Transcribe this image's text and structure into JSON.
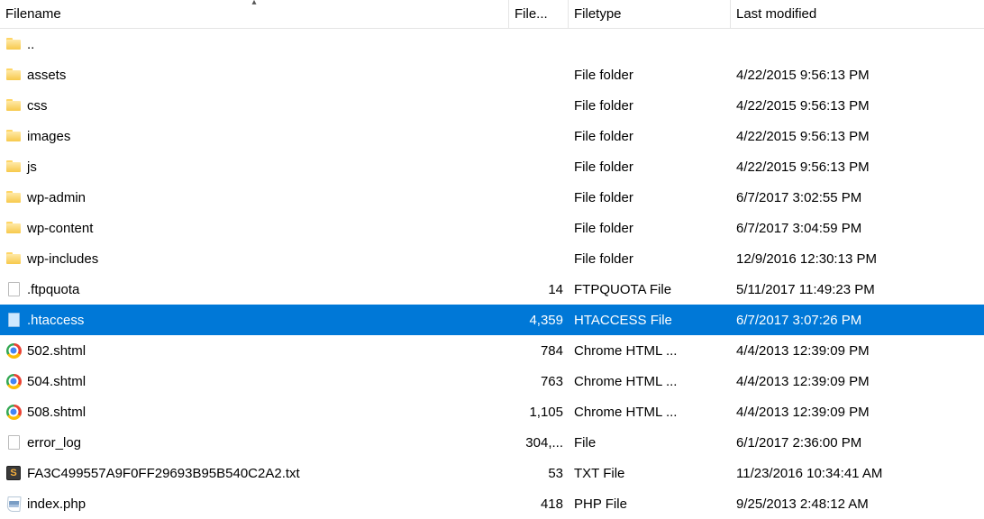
{
  "columns": {
    "filename": "Filename",
    "filesize": "File...",
    "filetype": "Filetype",
    "modified": "Last modified"
  },
  "rows": [
    {
      "icon": "folder",
      "name": "..",
      "size": "",
      "type": "",
      "modified": "",
      "selected": false
    },
    {
      "icon": "folder",
      "name": "assets",
      "size": "",
      "type": "File folder",
      "modified": "4/22/2015 9:56:13 PM",
      "selected": false
    },
    {
      "icon": "folder",
      "name": "css",
      "size": "",
      "type": "File folder",
      "modified": "4/22/2015 9:56:13 PM",
      "selected": false
    },
    {
      "icon": "folder",
      "name": "images",
      "size": "",
      "type": "File folder",
      "modified": "4/22/2015 9:56:13 PM",
      "selected": false
    },
    {
      "icon": "folder",
      "name": "js",
      "size": "",
      "type": "File folder",
      "modified": "4/22/2015 9:56:13 PM",
      "selected": false
    },
    {
      "icon": "folder",
      "name": "wp-admin",
      "size": "",
      "type": "File folder",
      "modified": "6/7/2017 3:02:55 PM",
      "selected": false
    },
    {
      "icon": "folder",
      "name": "wp-content",
      "size": "",
      "type": "File folder",
      "modified": "6/7/2017 3:04:59 PM",
      "selected": false
    },
    {
      "icon": "folder",
      "name": "wp-includes",
      "size": "",
      "type": "File folder",
      "modified": "12/9/2016 12:30:13 PM",
      "selected": false
    },
    {
      "icon": "file",
      "name": ".ftpquota",
      "size": "14",
      "type": "FTPQUOTA File",
      "modified": "5/11/2017 11:49:23 PM",
      "selected": false
    },
    {
      "icon": "file-blue",
      "name": ".htaccess",
      "size": "4,359",
      "type": "HTACCESS File",
      "modified": "6/7/2017 3:07:26 PM",
      "selected": true
    },
    {
      "icon": "chrome",
      "name": "502.shtml",
      "size": "784",
      "type": "Chrome HTML ...",
      "modified": "4/4/2013 12:39:09 PM",
      "selected": false
    },
    {
      "icon": "chrome",
      "name": "504.shtml",
      "size": "763",
      "type": "Chrome HTML ...",
      "modified": "4/4/2013 12:39:09 PM",
      "selected": false
    },
    {
      "icon": "chrome",
      "name": "508.shtml",
      "size": "1,105",
      "type": "Chrome HTML ...",
      "modified": "4/4/2013 12:39:09 PM",
      "selected": false
    },
    {
      "icon": "file",
      "name": "error_log",
      "size": "304,...",
      "type": "File",
      "modified": "6/1/2017 2:36:00 PM",
      "selected": false
    },
    {
      "icon": "s",
      "name": "FA3C499557A9F0FF29693B95B540C2A2.txt",
      "size": "53",
      "type": "TXT File",
      "modified": "11/23/2016 10:34:41 AM",
      "selected": false
    },
    {
      "icon": "php",
      "name": "index.php",
      "size": "418",
      "type": "PHP File",
      "modified": "9/25/2013 2:48:12 AM",
      "selected": false
    }
  ]
}
